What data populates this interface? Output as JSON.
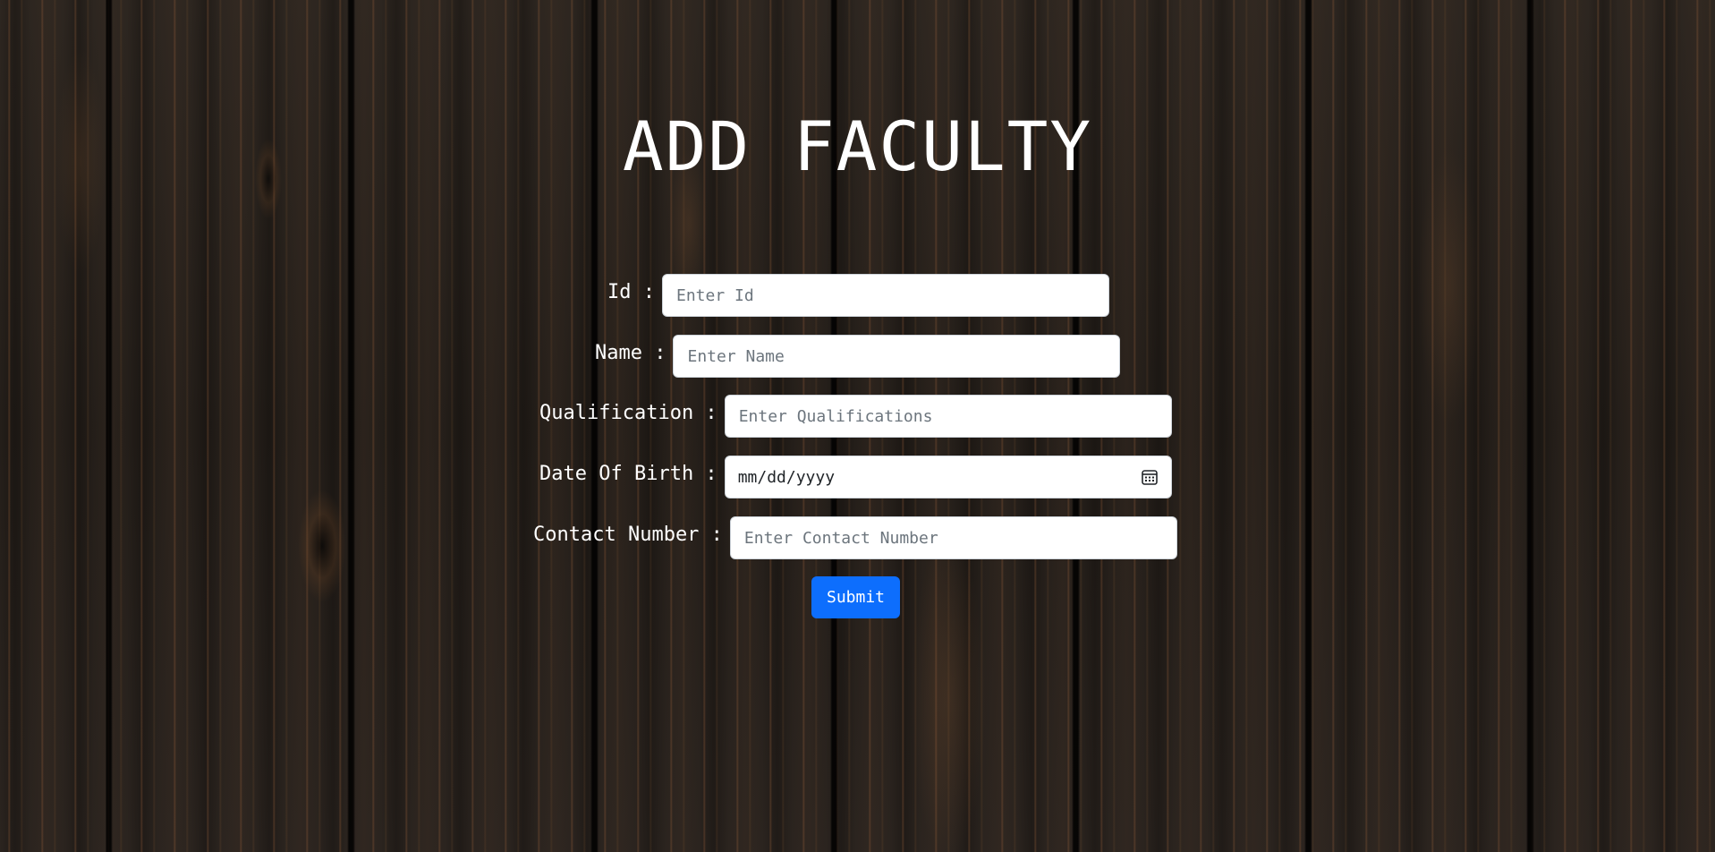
{
  "page": {
    "title": "ADD FACULTY"
  },
  "form": {
    "id": {
      "label": "Id :",
      "placeholder": "Enter Id",
      "value": ""
    },
    "name": {
      "label": "Name :",
      "placeholder": "Enter Name",
      "value": ""
    },
    "qualification": {
      "label": "Qualification :",
      "placeholder": "Enter Qualifications",
      "value": ""
    },
    "dob": {
      "label": "Date Of Birth :",
      "value": "mm/dd/yyyy",
      "icon": "calendar-icon"
    },
    "contact": {
      "label": "Contact Number :",
      "placeholder": "Enter Contact Number",
      "value": ""
    },
    "submit_label": "Submit"
  },
  "colors": {
    "primary_button": "#0d6efd",
    "label_text": "#ffffff",
    "placeholder_text": "#6c757d"
  }
}
